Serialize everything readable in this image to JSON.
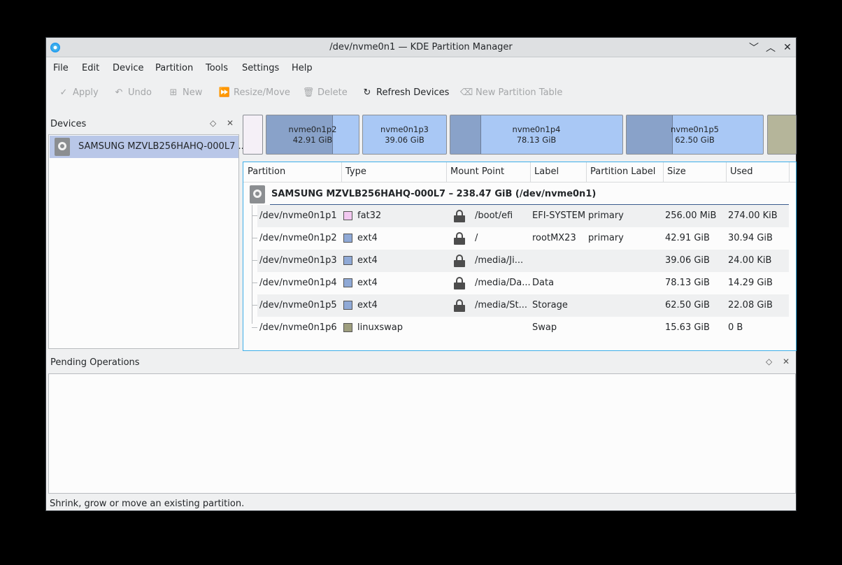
{
  "window": {
    "title": "/dev/nvme0n1 — KDE Partition Manager",
    "controls": {
      "minimize": "﹀",
      "maximize": "︿",
      "close": "✕"
    }
  },
  "menu": [
    "File",
    "Edit",
    "Device",
    "Partition",
    "Tools",
    "Settings",
    "Help"
  ],
  "toolbar": {
    "apply": "Apply",
    "undo": "Undo",
    "new": "New",
    "resize": "Resize/Move",
    "delete": "Delete",
    "refresh": "Refresh Devices",
    "new_table": "New Partition Table"
  },
  "devices_panel": {
    "title": "Devices",
    "float_icon": "◇",
    "close_icon": "✕",
    "items": [
      {
        "label": "SAMSUNG MZVLB256HAHQ-000L7 ..."
      }
    ]
  },
  "partition_bar": [
    {
      "name": "",
      "size": "",
      "color": "#f5f0f7",
      "used_fraction": 0
    },
    {
      "name": "nvme0n1p2",
      "size": "42.91 GiB",
      "color": "#a9c8f5",
      "used_fraction": 0.72
    },
    {
      "name": "nvme0n1p3",
      "size": "39.06 GiB",
      "color": "#a9c8f5",
      "used_fraction": 0
    },
    {
      "name": "nvme0n1p4",
      "size": "78.13 GiB",
      "color": "#a9c8f5",
      "used_fraction": 0.18
    },
    {
      "name": "nvme0n1p5",
      "size": "62.50 GiB",
      "color": "#a9c8f5",
      "used_fraction": 0.34
    },
    {
      "name": "",
      "size": "",
      "color": "#b5b59a",
      "used_fraction": 0
    }
  ],
  "table": {
    "headers": {
      "partition": "Partition",
      "type": "Type",
      "mount": "Mount Point",
      "label": "Label",
      "plabel": "Partition Label",
      "size": "Size",
      "used": "Used"
    },
    "disk": "SAMSUNG MZVLB256HAHQ-000L7 – 238.47 GiB (/dev/nvme0n1)",
    "rows": [
      {
        "partition": "/dev/nvme0n1p1",
        "type": "fat32",
        "color": "#f2c8f0",
        "locked": true,
        "mount": "/boot/efi",
        "label": "EFI-SYSTEM",
        "plabel": "primary",
        "size": "256.00 MiB",
        "used": "274.00 KiB"
      },
      {
        "partition": "/dev/nvme0n1p2",
        "type": "ext4",
        "color": "#8fa9d6",
        "locked": true,
        "mount": "/",
        "label": "rootMX23",
        "plabel": "primary",
        "size": "42.91 GiB",
        "used": "30.94 GiB"
      },
      {
        "partition": "/dev/nvme0n1p3",
        "type": "ext4",
        "color": "#8fa9d6",
        "locked": true,
        "mount": "/media/Ji...",
        "label": "",
        "plabel": "",
        "size": "39.06 GiB",
        "used": "24.00 KiB"
      },
      {
        "partition": "/dev/nvme0n1p4",
        "type": "ext4",
        "color": "#8fa9d6",
        "locked": true,
        "mount": "/media/Da...",
        "label": "Data",
        "plabel": "",
        "size": "78.13 GiB",
        "used": "14.29 GiB"
      },
      {
        "partition": "/dev/nvme0n1p5",
        "type": "ext4",
        "color": "#8fa9d6",
        "locked": true,
        "mount": "/media/St...",
        "label": "Storage",
        "plabel": "",
        "size": "62.50 GiB",
        "used": "22.08 GiB"
      },
      {
        "partition": "/dev/nvme0n1p6",
        "type": "linuxswap",
        "color": "#9e9e7e",
        "locked": false,
        "mount": "",
        "label": "Swap",
        "plabel": "",
        "size": "15.63 GiB",
        "used": "0 B"
      }
    ]
  },
  "pending": {
    "title": "Pending Operations",
    "float_icon": "◇",
    "close_icon": "✕"
  },
  "status": "Shrink, grow or move an existing partition."
}
